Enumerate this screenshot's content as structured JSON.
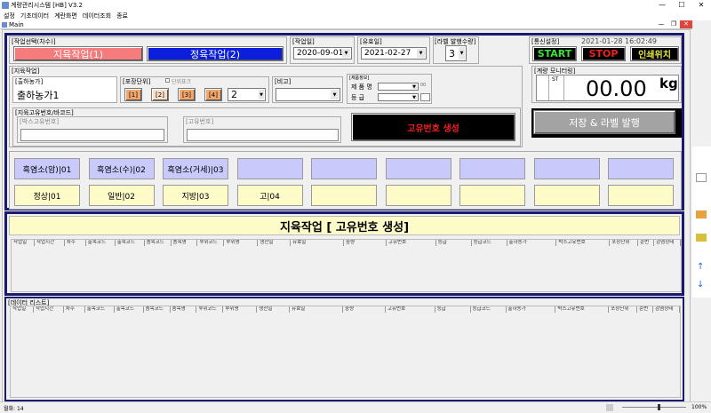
{
  "app": {
    "title": "계량관리시스템 [HB] V3.2",
    "menu": [
      "설정",
      "기초데이터",
      "계란화면",
      "데이터조회",
      "종료"
    ],
    "window_title": "Main"
  },
  "work_select": {
    "label": "[작업선택(차수)]",
    "btn1": "지육작업(1)",
    "btn2": "정육작업(2)"
  },
  "work_date": {
    "label": "[작업일]",
    "value": "2020-09-01"
  },
  "expiry_date": {
    "label": "[유효일]",
    "value": "2021-02-27"
  },
  "label_count": {
    "label": "[라벨 발행수량]",
    "value": "3"
  },
  "comm": {
    "label": "[통신설정]",
    "datetime": "2021-01-28 16:02:49",
    "start": "START",
    "stop": "STOP",
    "print": "인쇄위치"
  },
  "jiyuk": {
    "label": "[지육작업]",
    "shipper_label": "[출하농가]",
    "shipper_value": "출하농가1",
    "pack_label": "[포장단위]",
    "pack_check": "단위표크",
    "pack_buttons": [
      "[1]",
      "[2]",
      "[3]",
      "[4]"
    ],
    "pack_value": "2",
    "note_label": "[비고]",
    "product_info_label": "[제품정보]",
    "product_name_label": "제 품 명",
    "grade_label": "등    급",
    "product_suffix": "00"
  },
  "barcode": {
    "label": "[지육고유번호/바코드]",
    "box_label": "[박스고유번호]",
    "unique_label": "[고유번호]",
    "generate": "고유번호 생성"
  },
  "monitor": {
    "label": "[계량 모니터링]",
    "st": "ST",
    "weight": "00.00",
    "unit": "kg"
  },
  "save_button": "저장 & 라벨 발행",
  "categories_row1": [
    "흑염소(암)|01",
    "흑염소(수)|02",
    "흑염소(거세)|03",
    "",
    "",
    "",
    "",
    "",
    ""
  ],
  "categories_row2": [
    "정상|01",
    "일반|02",
    "지방|03",
    "고|04",
    "",
    "",
    "",
    "",
    ""
  ],
  "banner": "지육작업 [ 고유번호 생성]",
  "grid_columns": [
    "작업일",
    "작업시간",
    "차수",
    "출목코드",
    "출목코드",
    "품목코드",
    "품목명",
    "부위코드",
    "부위명",
    "생산일",
    "유효일",
    "중량",
    "고유번호",
    "등급",
    "등급코드",
    "출하농가",
    "박스고유번호",
    "포장단위",
    "순번",
    "감염상태"
  ],
  "data_list_label": "[데이터 리스트]",
  "status": {
    "left": "월화: 14",
    "zoom": "100%"
  }
}
